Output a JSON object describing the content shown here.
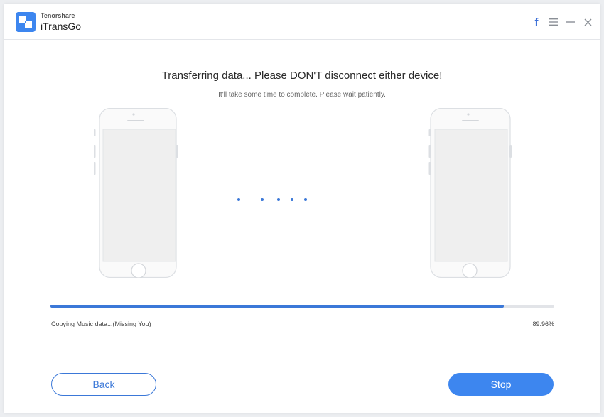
{
  "app": {
    "company": "Tenorshare",
    "name": "iTransGo",
    "accent_color": "#3b78d8"
  },
  "window_controls": {
    "facebook_label": "f",
    "icons": [
      "facebook-icon",
      "menu-icon",
      "minimize-icon",
      "close-icon"
    ]
  },
  "transfer": {
    "heading": "Transferring data... Please DON'T disconnect either device!",
    "subheading": "It'll take some time to complete. Please wait patiently.",
    "status": "Copying Music data...(Missing You)",
    "percent_label": "89.96%",
    "progress": 0.8996
  },
  "buttons": {
    "back": "Back",
    "stop": "Stop"
  }
}
